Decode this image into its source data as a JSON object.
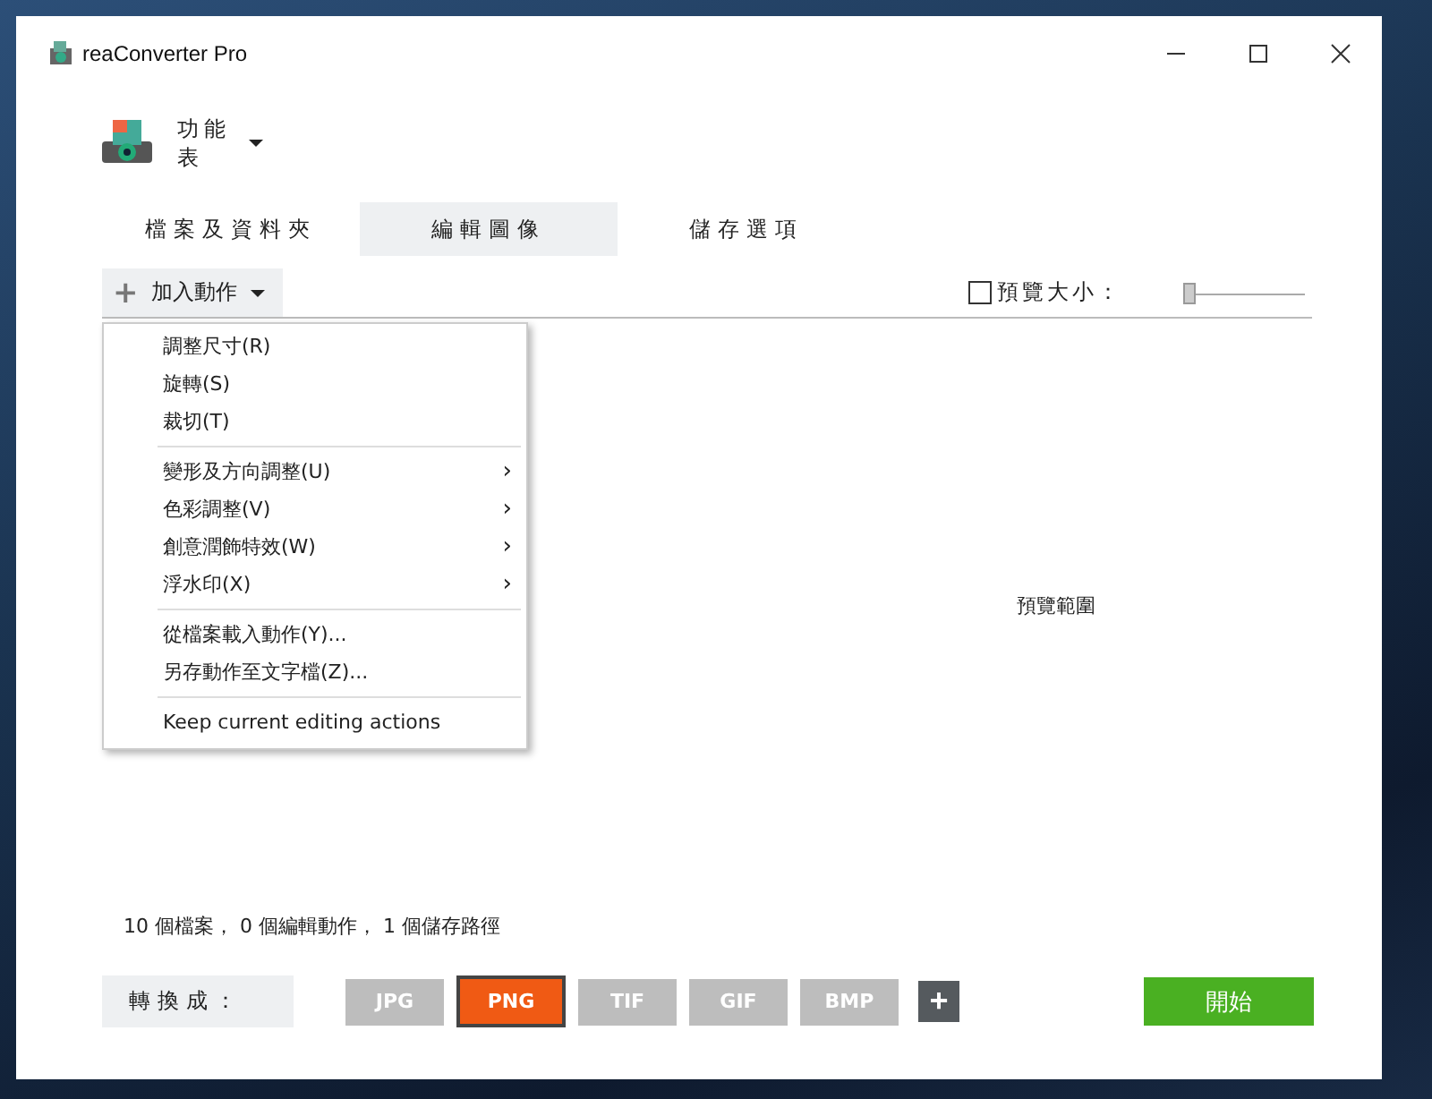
{
  "window": {
    "title": "reaConverter Pro"
  },
  "app_menu": {
    "label": "功能表"
  },
  "tabs": [
    {
      "label": "檔案及資料夾",
      "selected": false
    },
    {
      "label": "編輯圖像",
      "selected": true
    },
    {
      "label": "儲存選項",
      "selected": false
    }
  ],
  "add_action": {
    "label": "加入動作",
    "icon": "+"
  },
  "preview_size": {
    "label": "預覽大小：",
    "checked": false,
    "level": 0
  },
  "preview_area": {
    "label": "預覽範圍"
  },
  "dropdown_menu": {
    "groups": [
      [
        {
          "label": "調整尺寸(R)"
        },
        {
          "label": "旋轉(S)"
        },
        {
          "label": "裁切(T)"
        }
      ],
      [
        {
          "label": "變形及方向調整(U)",
          "arrow": "›"
        },
        {
          "label": "色彩調整(V)",
          "arrow": "›"
        },
        {
          "label": "創意潤飾特效(W)",
          "arrow": "›"
        },
        {
          "label": "浮水印(X)",
          "arrow": "›"
        }
      ],
      [
        {
          "label": "從檔案載入動作(Y)..."
        },
        {
          "label": "另存動作至文字檔(Z)..."
        }
      ],
      [
        {
          "label": "Keep current editing actions"
        }
      ]
    ]
  },
  "status": "10 個檔案， 0 個編輯動作， 1 個儲存路徑",
  "convert_to": {
    "label": "轉換成：",
    "formats": [
      {
        "label": "JPG",
        "selected": false
      },
      {
        "label": "PNG",
        "selected": true
      },
      {
        "label": "TIF",
        "selected": false
      },
      {
        "label": "GIF",
        "selected": false
      },
      {
        "label": "BMP",
        "selected": false
      }
    ],
    "add": "+"
  },
  "start_button": "開始"
}
